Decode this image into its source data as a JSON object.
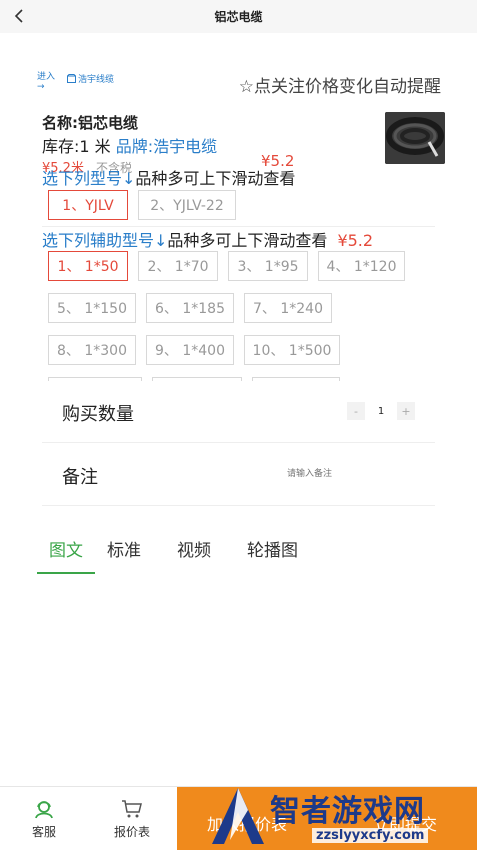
{
  "header": {
    "title": "铝芯电缆"
  },
  "shop": {
    "enter": "进入 →",
    "name": "浩宇线缆",
    "follow": "☆点关注价格变化自动提醒"
  },
  "product": {
    "name": "名称:铝芯电缆",
    "stock": "库存:1 米",
    "brand": "品牌:浩宇电缆",
    "price": "¥5.2米",
    "tax": "不含税",
    "price2": "¥5.2"
  },
  "series": {
    "hint_link": "选下列型号↓",
    "hint_text": "品种多可上下滑动查看",
    "options": [
      "1、YJLV",
      "2、YJLV-22"
    ]
  },
  "aux": {
    "hint_link": "选下列辅助型号↓",
    "hint_text": "品种多可上下滑动查看",
    "price": "¥5.2",
    "options": [
      "1、 1*50",
      "2、 1*70",
      "3、 1*95",
      "4、 1*120",
      "5、 1*150",
      "6、 1*185",
      "7、 1*240",
      "8、 1*300",
      "9、 1*400",
      "10、 1*500"
    ]
  },
  "quantity": {
    "label": "购买数量",
    "minus": "-",
    "value": "1",
    "plus": "+"
  },
  "remark": {
    "label": "备注",
    "placeholder": "请输入备注"
  },
  "tabs": [
    "图文",
    "标准",
    "视频",
    "轮播图"
  ],
  "bottom": {
    "service": "客服",
    "quote": "报价表",
    "cta_left": "加入报价表",
    "cta_right": "立即提交"
  },
  "watermark": {
    "big": "智者游戏网",
    "small": "zzslyyxcfy.com"
  },
  "colors": {
    "accent_green": "#3aa548",
    "price_red": "#e4493a",
    "link_blue": "#2a7ec9",
    "cta_orange": "#f08a1c"
  }
}
